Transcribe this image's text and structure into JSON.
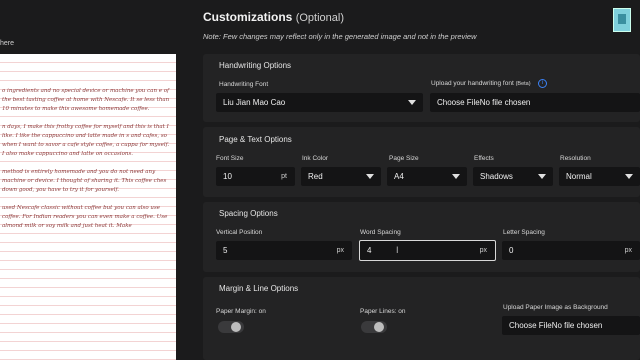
{
  "preview": {
    "heading_fragment": "here",
    "paragraphs": [
      "o ingredients and no special device or machine you can e of the best tasting coffee at home with Nescafe. It se less than 10 minutes to make this awesome homemade coffee.",
      "n days, I make this frothy coffee for myself and this is that I like. I like the cappuccino and latte made in s and cafes, so when I want to savor a cafe style coffee, a cuppa for myself. I also make cappuccino and latte on occasions.",
      "method is entirely homemade and you do not need any machine or device. I thought of sharing it. This coffee ches down good, you have to try it for yourself.",
      "used Nescafe classic without coffee but you can also use coffee. For Indian readers you can even make a coffee. Use almond milk or soy milk and just heat it. Make"
    ]
  },
  "header": {
    "title": "Customizations",
    "title_suffix": "(Optional)",
    "note": "Note: Few changes may reflect only in the generated image and not in the preview"
  },
  "handwriting": {
    "section_title": "Handwriting Options",
    "font_label": "Handwriting Font",
    "font_value": "Liu Jian Mao Cao",
    "upload_label": "Upload your handwriting font",
    "upload_beta": "(Beta)",
    "upload_button": "Choose FileNo file chosen",
    "info_glyph": "i"
  },
  "page_text": {
    "section_title": "Page & Text Options",
    "font_size_label": "Font Size",
    "font_size_value": "10",
    "font_size_unit": "pt",
    "ink_color_label": "Ink Color",
    "ink_color_value": "Red",
    "page_size_label": "Page Size",
    "page_size_value": "A4",
    "effects_label": "Effects",
    "effects_value": "Shadows",
    "resolution_label": "Resolution",
    "resolution_value": "Normal"
  },
  "spacing": {
    "section_title": "Spacing Options",
    "vertical_label": "Vertical Position",
    "vertical_value": "5",
    "vertical_unit": "px",
    "word_label": "Word Spacing",
    "word_value": "4",
    "word_unit": "px",
    "letter_label": "Letter Spacing",
    "letter_value": "0",
    "letter_unit": "px"
  },
  "margin_line": {
    "section_title": "Margin & Line Options",
    "paper_margin_label": "Paper Margin: on",
    "paper_lines_label": "Paper Lines: on",
    "bg_upload_label": "Upload Paper Image as Background",
    "bg_upload_button": "Choose FileNo file chosen"
  },
  "colors": {
    "accent": "#3b82f6",
    "ink": "#8a3b3b",
    "card": "#232324",
    "input": "#141415"
  }
}
